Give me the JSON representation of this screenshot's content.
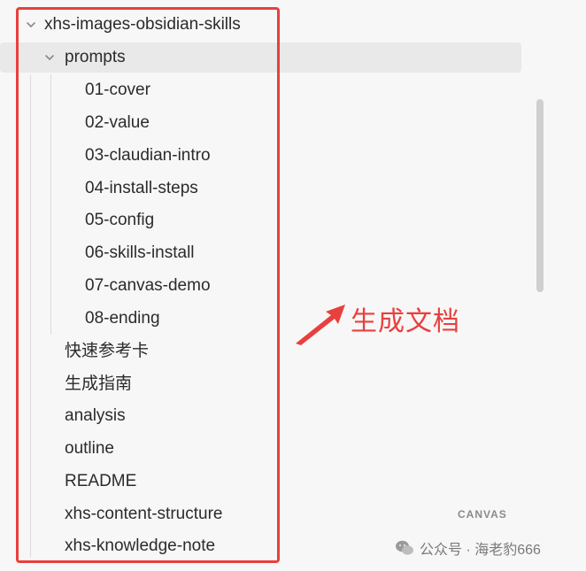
{
  "tree": {
    "root": {
      "label": "xhs-images-obsidian-skills",
      "expanded": true
    },
    "folder": {
      "label": "prompts",
      "expanded": true
    },
    "prompt_files": [
      "01-cover",
      "02-value",
      "03-claudian-intro",
      "04-install-steps",
      "05-config",
      "06-skills-install",
      "07-canvas-demo",
      "08-ending"
    ],
    "root_files": [
      "快速参考卡",
      "生成指南",
      "analysis",
      "outline",
      "README",
      "xhs-content-structure",
      "xhs-knowledge-note"
    ]
  },
  "annotation": {
    "text": "生成文档",
    "color": "#e8403d"
  },
  "badge": {
    "canvas": "CANVAS"
  },
  "watermark": {
    "text": "公众号 · 海老豹666"
  }
}
